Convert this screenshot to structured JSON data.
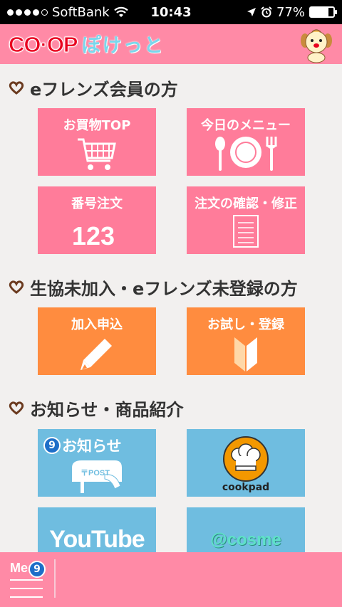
{
  "status_bar": {
    "carrier": "SoftBank",
    "time": "10:43",
    "battery": "77%",
    "battery_level": 0.77
  },
  "header": {
    "logo_coop": "CO·OP",
    "logo_pocket": "ぽけっと"
  },
  "sections": [
    {
      "title": "eフレンズ会員の方"
    },
    {
      "title": "生協未加入・eフレンズ未登録の方"
    },
    {
      "title": "お知らせ・商品紹介"
    }
  ],
  "tiles": {
    "shopping_top": "お買物TOP",
    "todays_menu": "今日のメニュー",
    "number_order": "番号注文",
    "order_confirm": "注文の確認・修正",
    "number_glyphs": "123",
    "join_apply": "加入申込",
    "trial_register": "お試し・登録",
    "notices": "お知らせ",
    "notices_badge": "9",
    "post_label": "〒POST",
    "cookpad": "cookpad",
    "youtube": "YouTube",
    "cosme": "@cosme"
  },
  "bottom_menu": {
    "label": "Me",
    "badge": "9"
  },
  "colors": {
    "header_pink": "#ff8aa6",
    "tile_pink": "#ff7c9a",
    "tile_orange": "#ff8c3f",
    "tile_blue": "#6fbde0",
    "coop_red": "#e8001f"
  }
}
